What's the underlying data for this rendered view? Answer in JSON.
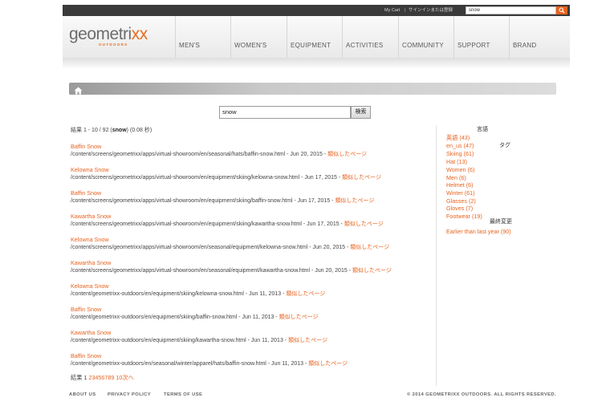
{
  "topbar": {
    "cart": "My Cart",
    "separator": "|",
    "signin": "サインインまたは登録",
    "search_value": "snow"
  },
  "logo": {
    "word_a": "geometri",
    "word_b": "xx",
    "sub": "OUTDOORS"
  },
  "nav": [
    "MEN'S",
    "WOMEN'S",
    "EQUIPMENT",
    "ACTIVITIES",
    "COMMUNITY",
    "SUPPORT",
    "BRAND"
  ],
  "search": {
    "value": "snow",
    "button": "検索"
  },
  "summary": {
    "prefix": "結果 1 - 10 / 92 (",
    "query": "snow",
    "suffix": ") (0.08 秒)"
  },
  "results": [
    {
      "title": "Baffin Snow",
      "path": "/content/screens/geometrixx/apps/virtual-showroom/en/seasonal/hats/baffin-snow.html - Jun 20, 2015 - ",
      "similar": "類似したページ"
    },
    {
      "title": "Kelowna Snow",
      "path": "/content/screens/geometrixx/apps/virtual-showroom/en/equipment/skiing/kelowna-snow.html - Jun 17, 2015 - ",
      "similar": "類似したページ"
    },
    {
      "title": "Baffin Snow",
      "path": "/content/screens/geometrixx/apps/virtual-showroom/en/equipment/skiing/baffin-snow.html - Jun 17, 2015 - ",
      "similar": "類似したページ"
    },
    {
      "title": "Kawartha Snow",
      "path": "/content/screens/geometrixx/apps/virtual-showroom/en/equipment/skiing/kawartha-snow.html - Jun 17, 2015 - ",
      "similar": "類似したページ"
    },
    {
      "title": "Kelowna Snow",
      "path": "/content/screens/geometrixx/apps/virtual-showroom/en/seasonal/equipment/kelowna-snow.html - Jun 20, 2015 - ",
      "similar": "類似したページ"
    },
    {
      "title": "Kawartha Snow",
      "path": "/content/screens/geometrixx/apps/virtual-showroom/en/seasonal/equipment/kawartha-snow.html - Jun 20, 2015 - ",
      "similar": "類似したページ"
    },
    {
      "title": "Kelowna Snow",
      "path": "/content/geometrixx-outdoors/en/equipment/skiing/kelowna-snow.html - Jun 11, 2013 - ",
      "similar": "類似したページ"
    },
    {
      "title": "Baffin Snow",
      "path": "/content/geometrixx-outdoors/en/equipment/skiing/baffin-snow.html - Jun 11, 2013 - ",
      "similar": "類似したページ"
    },
    {
      "title": "Kawartha Snow",
      "path": "/content/geometrixx-outdoors/en/equipment/skiing/kawartha-snow.html - Jun 11, 2013 - ",
      "similar": "類似したページ"
    },
    {
      "title": "Baffin Snow",
      "path": "/content/geometrixx-outdoors/en/seasonal/winter/apparel/hats/baffin-snow.html - Jun 11, 2013 - ",
      "similar": "類似したページ"
    }
  ],
  "pager": {
    "label": "結果",
    "current": "1",
    "pages": [
      "2",
      "3",
      "4",
      "5",
      "6",
      "7",
      "8",
      "9",
      "10"
    ],
    "next": "次へ"
  },
  "facets": {
    "language_head": "言語",
    "languages": [
      "英語 (43)",
      "en_us (47)"
    ],
    "tag_head": "タグ",
    "tags": [
      "Skiing (61)",
      "Hat (13)",
      "Women (6)",
      "Men (6)",
      "Helmet (6)",
      "Winter (61)",
      "Glasses (2)",
      "Gloves (7)",
      "Footwear (19)"
    ],
    "modified_head": "最終変更",
    "modified": [
      "Earlier than last year (90)"
    ]
  },
  "footer": {
    "about": "ABOUT US",
    "privacy": "PRIVACY POLICY",
    "terms": "TERMS OF USE",
    "copyright": "© 2014 GEOMETRIXX OUTDOORS. ALL RIGHTS RESERVED."
  },
  "colors": {
    "accent": "#e8631f",
    "topbar": "#3a3a3a"
  },
  "icons": {
    "home": "home-icon",
    "search": "search-icon"
  }
}
